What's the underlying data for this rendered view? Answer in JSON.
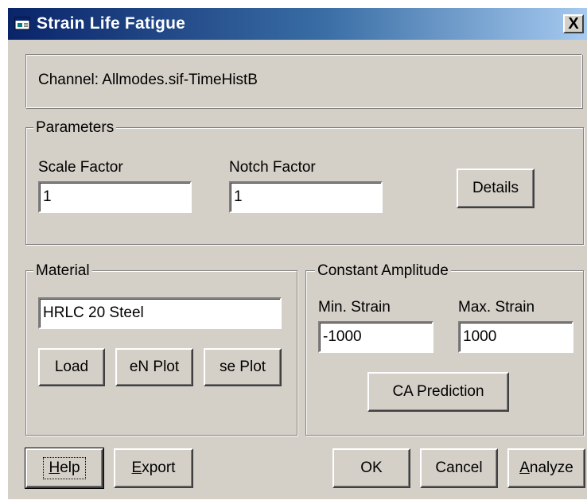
{
  "window": {
    "title": "Strain Life Fatigue",
    "close_label": "X"
  },
  "channel": {
    "text": "Channel: Allmodes.sif-TimeHistB"
  },
  "parameters": {
    "legend": "Parameters",
    "scale_factor_label": "Scale Factor",
    "scale_factor_value": "1",
    "notch_factor_label": "Notch Factor",
    "notch_factor_value": "1",
    "details_label": "Details"
  },
  "material": {
    "legend": "Material",
    "name_value": "HRLC 20 Steel",
    "load_label": "Load",
    "en_plot_label": "eN Plot",
    "se_plot_label": "se Plot"
  },
  "constant_amplitude": {
    "legend": "Constant Amplitude",
    "min_strain_label": "Min. Strain",
    "min_strain_value": "-1000",
    "max_strain_label": "Max. Strain",
    "max_strain_value": "1000",
    "ca_prediction_label": "CA Prediction"
  },
  "footer": {
    "help_accel": "H",
    "help_rest": "elp",
    "export_accel": "E",
    "export_rest": "xport",
    "ok_label": "OK",
    "cancel_label": "Cancel",
    "analyze_accel": "A",
    "analyze_rest": "nalyze"
  }
}
